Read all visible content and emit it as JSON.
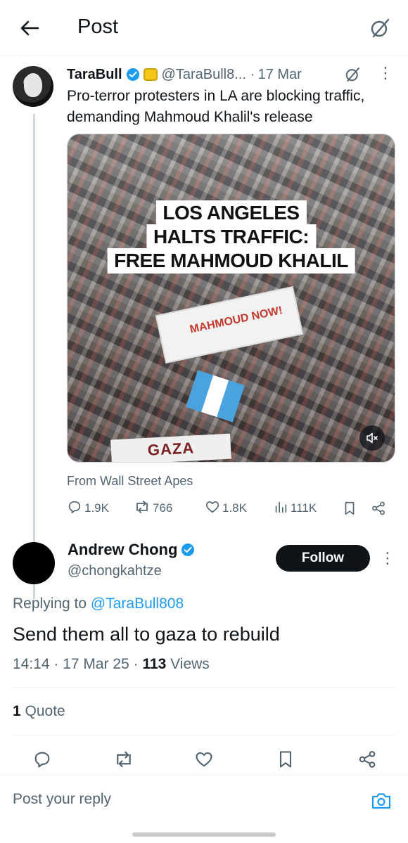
{
  "header": {
    "title": "Post"
  },
  "parent_post": {
    "name": "TaraBull",
    "handle": "@TaraBull8...",
    "date": "17 Mar",
    "text": "Pro-terror protesters in LA are blocking traffic, demanding Mahmoud Khalil's release",
    "media": {
      "caption_lines": [
        "LOS ANGELES",
        "HALTS TRAFFIC:",
        "FREE MAHMOUD KHALIL"
      ],
      "banner_text": "MAHMOUD NOW!",
      "sign_text": "GAZA RESISTS"
    },
    "source": "From Wall Street Apes",
    "stats": {
      "replies": "1.9K",
      "reposts": "766",
      "likes": "1.8K",
      "views": "111K"
    }
  },
  "reply_post": {
    "name": "Andrew Chong",
    "handle": "@chongkahtze",
    "follow_label": "Follow",
    "replying_prefix": "Replying to ",
    "replying_to": "@TaraBull808",
    "text": "Send them all to gaza to rebuild",
    "timestamp": "14:14 · 17 Mar 25 · ",
    "views_count": "113",
    "views_label": " Views",
    "quote_count": "1",
    "quote_label": " Quote"
  },
  "composer": {
    "placeholder": "Post your reply"
  },
  "colors": {
    "accent": "#1d9bf0",
    "text_primary": "#0f1419",
    "text_secondary": "#536471"
  }
}
